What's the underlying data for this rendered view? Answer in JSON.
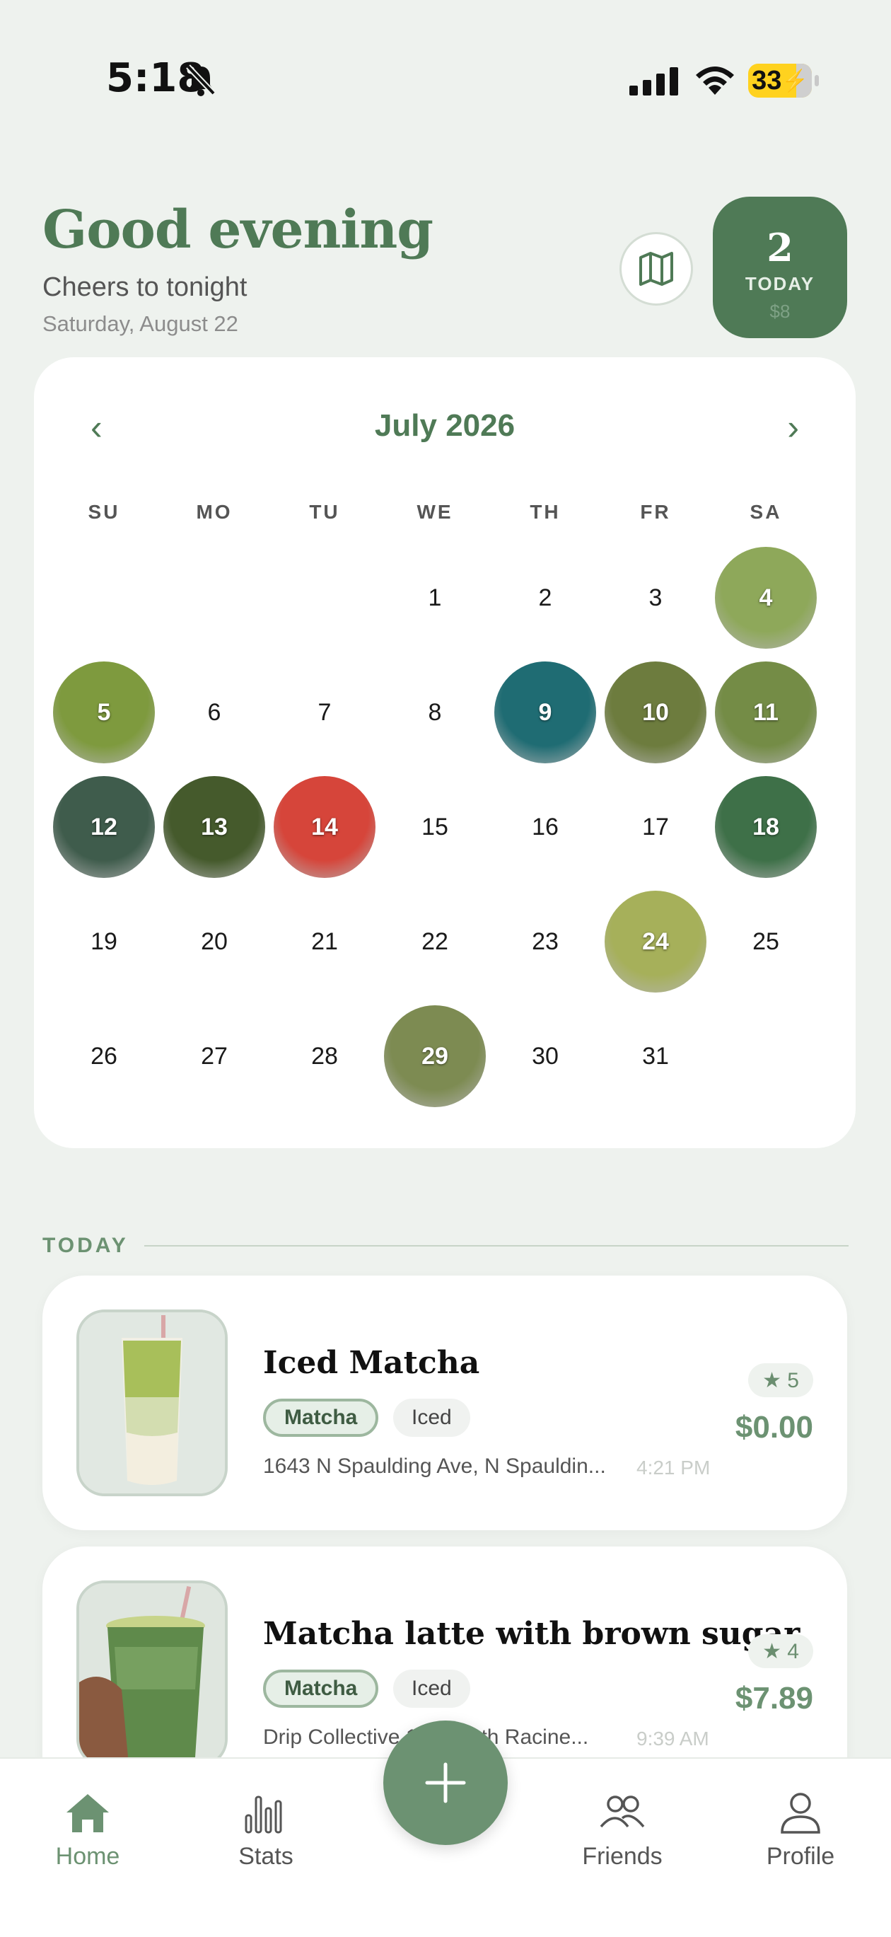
{
  "status": {
    "time": "5:18",
    "battery": "33"
  },
  "header": {
    "greeting": "Good evening",
    "subtitle": "Cheers to tonight",
    "date": "Saturday, August 22",
    "today_count": "2",
    "today_label": "TODAY",
    "today_price": "$8"
  },
  "calendar": {
    "month": "July 2026",
    "weekdays": [
      "SU",
      "MO",
      "TU",
      "WE",
      "TH",
      "FR",
      "SA"
    ],
    "weeks": [
      [
        "",
        "",
        "",
        "1",
        "2",
        "3",
        "4"
      ],
      [
        "5",
        "6",
        "7",
        "8",
        "9",
        "10",
        "11"
      ],
      [
        "12",
        "13",
        "14",
        "15",
        "16",
        "17",
        "18"
      ],
      [
        "19",
        "20",
        "21",
        "22",
        "23",
        "24",
        "25"
      ],
      [
        "26",
        "27",
        "28",
        "29",
        "30",
        "31",
        ""
      ]
    ],
    "photo_days": [
      "4",
      "5",
      "9",
      "10",
      "11",
      "12",
      "13",
      "14",
      "18",
      "24",
      "29"
    ]
  },
  "today_section": {
    "label": "TODAY"
  },
  "entries": [
    {
      "title": "Iced Matcha",
      "tags": [
        "Matcha",
        "Iced"
      ],
      "address": "1643 N Spaulding Ave, N Spauldin...",
      "time": "4:21 PM",
      "rating": "★ 5",
      "price": "$0.00"
    },
    {
      "title": "Matcha latte with brown sugar",
      "tags": [
        "Matcha",
        "Iced"
      ],
      "address": "Drip Collective 172 North Racine...",
      "time": "9:39 AM",
      "rating": "★ 4",
      "price": "$7.89"
    }
  ],
  "tabs": {
    "home": "Home",
    "stats": "Stats",
    "friends": "Friends",
    "profile": "Profile"
  },
  "colors": {
    "accent": "#4f7a56",
    "accent_light": "#6c9272",
    "background": "#eef2ee"
  }
}
